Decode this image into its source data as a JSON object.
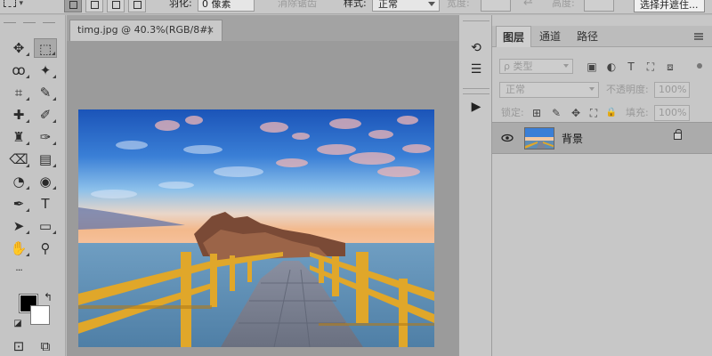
{
  "options_bar": {
    "feather_label": "羽化:",
    "feather_value": "0 像素",
    "antialias_label": "消除锯齿",
    "style_label": "样式:",
    "style_value": "正常",
    "width_label": "宽度:",
    "height_label": "高度:",
    "select_mask_button": "选择并遮住..."
  },
  "document": {
    "tab_title": "timg.jpg @ 40.3%(RGB/8#)",
    "close_glyph": "×"
  },
  "toolbar": {
    "tools": [
      {
        "icon": "move-icon",
        "glyph": "✥"
      },
      {
        "icon": "rect-marquee-icon",
        "glyph": "⬚"
      },
      {
        "icon": "lasso-icon",
        "glyph": "ꝏ"
      },
      {
        "icon": "magic-wand-icon",
        "glyph": "✦"
      },
      {
        "icon": "crop-icon",
        "glyph": "⌗"
      },
      {
        "icon": "eyedropper-icon",
        "glyph": "✎"
      },
      {
        "icon": "healing-brush-icon",
        "glyph": "✚"
      },
      {
        "icon": "brush-icon",
        "glyph": "✐"
      },
      {
        "icon": "clone-stamp-icon",
        "glyph": "♜"
      },
      {
        "icon": "history-brush-icon",
        "glyph": "✑"
      },
      {
        "icon": "eraser-icon",
        "glyph": "⌫"
      },
      {
        "icon": "gradient-icon",
        "glyph": "▤"
      },
      {
        "icon": "blur-icon",
        "glyph": "◔"
      },
      {
        "icon": "dodge-icon",
        "glyph": "◉"
      },
      {
        "icon": "pen-icon",
        "glyph": "✒"
      },
      {
        "icon": "type-icon",
        "glyph": "T"
      },
      {
        "icon": "path-selection-icon",
        "glyph": "➤"
      },
      {
        "icon": "rectangle-shape-icon",
        "glyph": "▭"
      },
      {
        "icon": "hand-icon",
        "glyph": "✋"
      },
      {
        "icon": "zoom-icon",
        "glyph": "⚲"
      },
      {
        "icon": "more-tools-icon",
        "glyph": "···"
      },
      {
        "icon": "quick-mask-icon",
        "glyph": "⊡"
      },
      {
        "icon": "screen-mode-icon",
        "glyph": "⧉"
      }
    ],
    "swap_glyph": "↰",
    "default_colors_glyph": "◪"
  },
  "mid_panel": {
    "history_glyph": "⟲",
    "properties_glyph": "☰",
    "play_glyph": "▶"
  },
  "layers_panel": {
    "tabs": [
      "图层",
      "通道",
      "路径"
    ],
    "filter_placeholder": "ρ 类型",
    "filter_icons": [
      "image-filter-icon",
      "adjust-filter-icon",
      "text-filter-icon",
      "shape-filter-icon",
      "smart-filter-icon"
    ],
    "filter_glyphs": [
      "▣",
      "◐",
      "T",
      "⛶",
      "⧈"
    ],
    "blend_mode": "正常",
    "opacity_label": "不透明度:",
    "opacity_value": "100%",
    "lock_label": "锁定:",
    "lock_glyphs": [
      "⊞",
      "✎",
      "✥",
      "⛶",
      "🔒"
    ],
    "fill_label": "填充:",
    "fill_value": "100%",
    "layer_name": "背景",
    "eye_glyph": "👁"
  },
  "colors": {
    "foreground": "#000000",
    "background": "#ffffff"
  }
}
